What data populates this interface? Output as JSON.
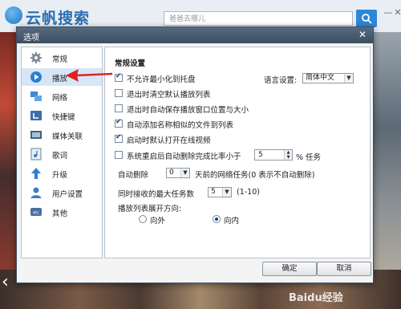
{
  "background_app": {
    "brand": "云帆搜索",
    "search_placeholder": "爸爸去哪儿",
    "window_controls": [
      "—",
      "✕"
    ],
    "watermark": "Baidu经验"
  },
  "dialog": {
    "title": "选项",
    "close_glyph": "✕",
    "sidebar": {
      "items": [
        {
          "label": "常规",
          "icon": "gear-icon"
        },
        {
          "label": "播放",
          "icon": "play-icon"
        },
        {
          "label": "网络",
          "icon": "network-icon"
        },
        {
          "label": "快捷键",
          "icon": "shortcut-icon"
        },
        {
          "label": "媒体关联",
          "icon": "media-association-icon"
        },
        {
          "label": "歌词",
          "icon": "lyrics-icon"
        },
        {
          "label": "升级",
          "icon": "upgrade-icon"
        },
        {
          "label": "用户设置",
          "icon": "user-icon"
        },
        {
          "label": "其他",
          "icon": "etc-icon"
        }
      ],
      "active_index": 1
    },
    "panel": {
      "section_title": "常规设置",
      "language_label": "语言设置:",
      "language_value": "简体中文",
      "options": [
        {
          "label": "不允许最小化到托盘",
          "checked": true
        },
        {
          "label": "退出时清空默认播放列表",
          "checked": false
        },
        {
          "label": "退出时自动保存播放窗口位置与大小",
          "checked": false
        },
        {
          "label": "自动添加名称相似的文件到列表",
          "checked": true
        },
        {
          "label": "启动时默认打开在线视频",
          "checked": true
        }
      ],
      "auto_delete_ratio": {
        "label": "系统重启后自动删除完成比率小于",
        "checked": false,
        "value": "5",
        "suffix": "% 任务"
      },
      "auto_delete_days": {
        "label": "自动删除",
        "value": "0",
        "suffix": "天前的网络任务(0 表示不自动删除)"
      },
      "max_tasks": {
        "label": "同时接收的最大任务数",
        "value": "5",
        "range": "(1-10)"
      },
      "playlist_direction": {
        "label": "播放列表展开方向:",
        "options": [
          {
            "label": "向外",
            "selected": false
          },
          {
            "label": "向内",
            "selected": true
          }
        ]
      }
    },
    "buttons": {
      "ok": "确定",
      "cancel": "取消"
    }
  },
  "colors": {
    "titlebar": "#3c4e61",
    "active_item_bg": "#d6e6f7",
    "annotation_arrow": "#e02020"
  }
}
